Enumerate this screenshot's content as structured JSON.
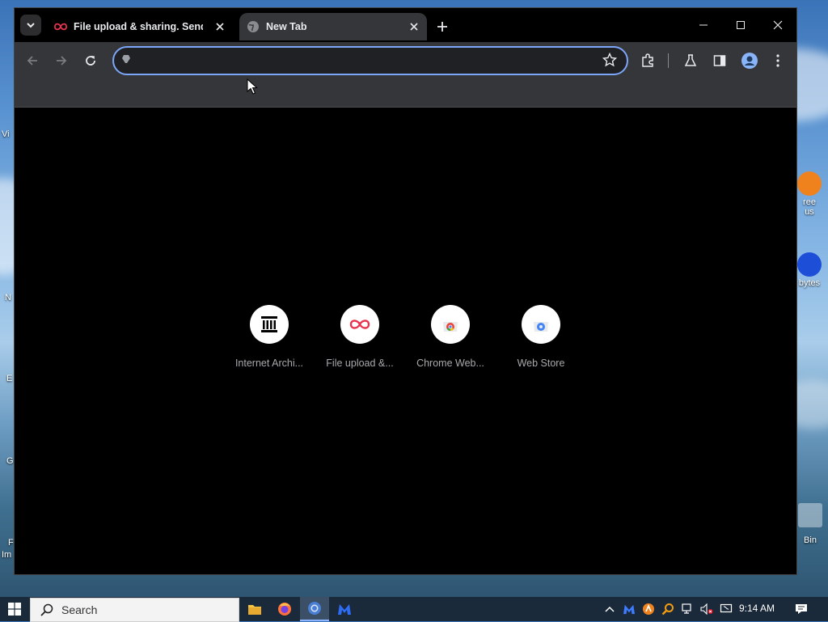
{
  "desktop": {
    "icon_labels": [
      "ree",
      "us",
      "bytes",
      "Bin",
      "Vi",
      "N",
      "E",
      "G",
      "F",
      "Im"
    ]
  },
  "browser": {
    "tabs": [
      {
        "title": "File upload & sharing. Send lar",
        "favicon": "filemail-icon",
        "active": false
      },
      {
        "title": "New Tab",
        "favicon": "globe-icon",
        "active": true
      }
    ],
    "omnibox": {
      "value": "",
      "placeholder": ""
    },
    "shortcuts": [
      {
        "label": "Internet Archi...",
        "icon": "internet-archive-icon"
      },
      {
        "label": "File upload &...",
        "icon": "filemail-icon"
      },
      {
        "label": "Chrome Web...",
        "icon": "chrome-web-store-icon"
      },
      {
        "label": "Web Store",
        "icon": "web-store-icon"
      }
    ]
  },
  "taskbar": {
    "search_placeholder": "Search",
    "clock": "9:14 AM"
  },
  "colors": {
    "accent": "#7ca6f7",
    "filemail_red": "#e8344e",
    "tab_active_bg": "#35363a"
  }
}
